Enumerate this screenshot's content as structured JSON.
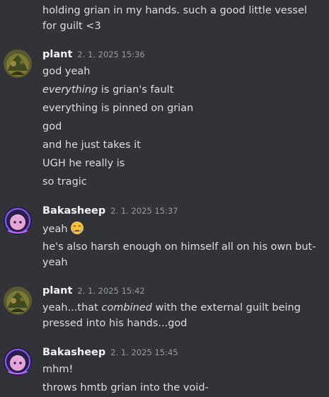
{
  "messages": {
    "m0": {
      "line1": "holding grian in my hands. such a good little vessel for guilt <3"
    },
    "m1": {
      "username": "plant",
      "timestamp": "2. 1. 2025 15:36",
      "lines": [
        "god yeah",
        "is grian's fault",
        "everything is pinned on grian",
        "god",
        "and he just takes it",
        "UGH he really is",
        "so tragic"
      ],
      "italic_word": "everything"
    },
    "m2": {
      "username": "Bakasheep",
      "timestamp": "2. 1. 2025 15:37",
      "line1": "yeah",
      "emoji": "crying-face",
      "line2": "he's also harsh enough on himself all on his own but- yeah"
    },
    "m3": {
      "username": "plant",
      "timestamp": "2. 1. 2025 15:42",
      "pre": "yeah...that ",
      "italic": "combined",
      "post": " with the external guilt being pressed into his hands...god"
    },
    "m4": {
      "username": "Bakasheep",
      "timestamp": "2. 1. 2025 15:45",
      "lines": [
        "mhm!",
        "throws hmtb grian into the void-"
      ]
    }
  },
  "colors": {
    "background": "#323339",
    "text": "#dbdee1",
    "username": "#f2f3f5",
    "timestamp": "#949ba4"
  }
}
